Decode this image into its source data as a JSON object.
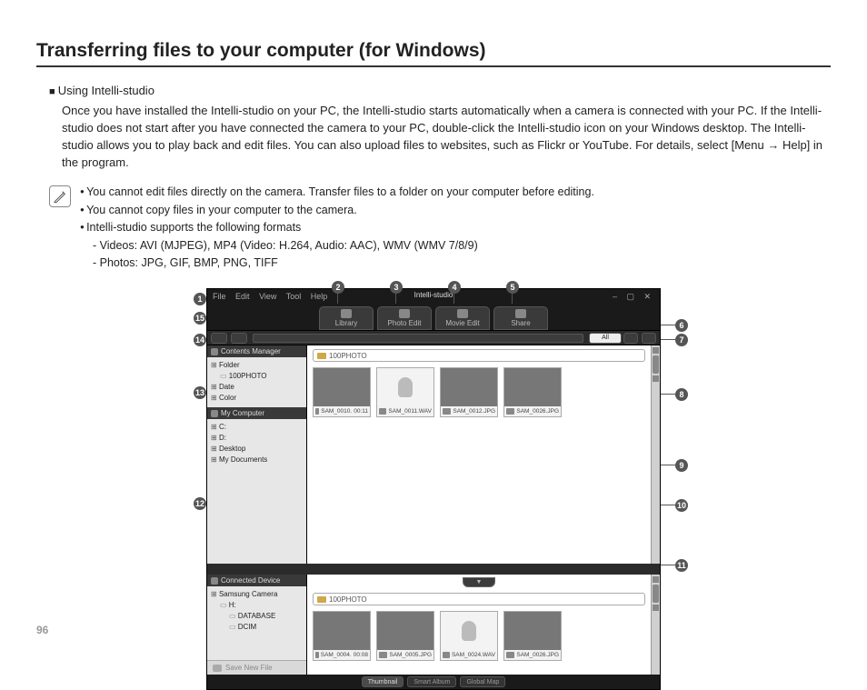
{
  "page_title": "Transferring files to your computer (for Windows)",
  "section_heading": "Using Intelli-studio",
  "body_text": "Once you have installed the Intelli-studio on your PC, the Intelli-studio starts automatically when a camera is connected with your PC. If the Intelli-studio does not start after you have connected the camera to your PC, double-click the Intelli-studio icon on your Windows desktop. The Intelli-studio allows you to play back and edit files. You can also upload files to websites, such as Flickr or YouTube. For details, select [Menu → Help] in the program.",
  "notes": {
    "n1": "You cannot edit files directly on the camera. Transfer files to a folder on your computer before editing.",
    "n2": "You cannot copy files in your computer to the camera.",
    "n3": "Intelli-studio supports the following formats",
    "n3a": "Videos: AVI (MJPEG), MP4 (Video: H.264, Audio: AAC), WMV (WMV 7/8/9)",
    "n3b": "Photos: JPG, GIF, BMP, PNG, TIFF"
  },
  "app": {
    "brand": "Intelli-studio",
    "menus": [
      "File",
      "Edit",
      "View",
      "Tool",
      "Help"
    ],
    "tabs": [
      "Library",
      "Photo Edit",
      "Movie Edit",
      "Share"
    ],
    "filter_all": "All",
    "sidebar": {
      "panel1": "Contents Manager",
      "folder": "Folder",
      "folder_sub": "100PHOTO",
      "date": "Date",
      "color": "Color",
      "panel2": "My Computer",
      "drives": [
        "C:",
        "D:",
        "Desktop",
        "My Documents"
      ],
      "panel3": "Connected Device",
      "camera": "Samsung Camera",
      "camera_sub": "H:",
      "camera_db": "DATABASE",
      "camera_dcim": "DCIM",
      "save": "Save New File"
    },
    "folderbar_top": "100PHOTO",
    "folderbar_bottom": "100PHOTO",
    "thumbs_top": [
      {
        "name": "SAM_0010.",
        "extra": "00:11"
      },
      {
        "name": "SAM_0011.WAV",
        "extra": ""
      },
      {
        "name": "SAM_0012.JPG",
        "extra": ""
      },
      {
        "name": "SAM_0026.JPG",
        "extra": ""
      }
    ],
    "thumbs_bottom": [
      {
        "name": "SAM_0004.",
        "extra": "00:08"
      },
      {
        "name": "SAM_0005.JPG",
        "extra": ""
      },
      {
        "name": "SAM_0024.WAV",
        "extra": ""
      },
      {
        "name": "SAM_0026.JPG",
        "extra": ""
      }
    ],
    "bottombar": [
      "Thumbnail",
      "Smart Album",
      "Global Map"
    ]
  },
  "callouts": {
    "c1": "1",
    "c2": "2",
    "c3": "3",
    "c4": "4",
    "c5": "5",
    "c6": "6",
    "c7": "7",
    "c8": "8",
    "c9": "9",
    "c10": "10",
    "c11": "11",
    "c12": "12",
    "c13": "13",
    "c14": "14",
    "c15": "15"
  },
  "page_number": "96"
}
